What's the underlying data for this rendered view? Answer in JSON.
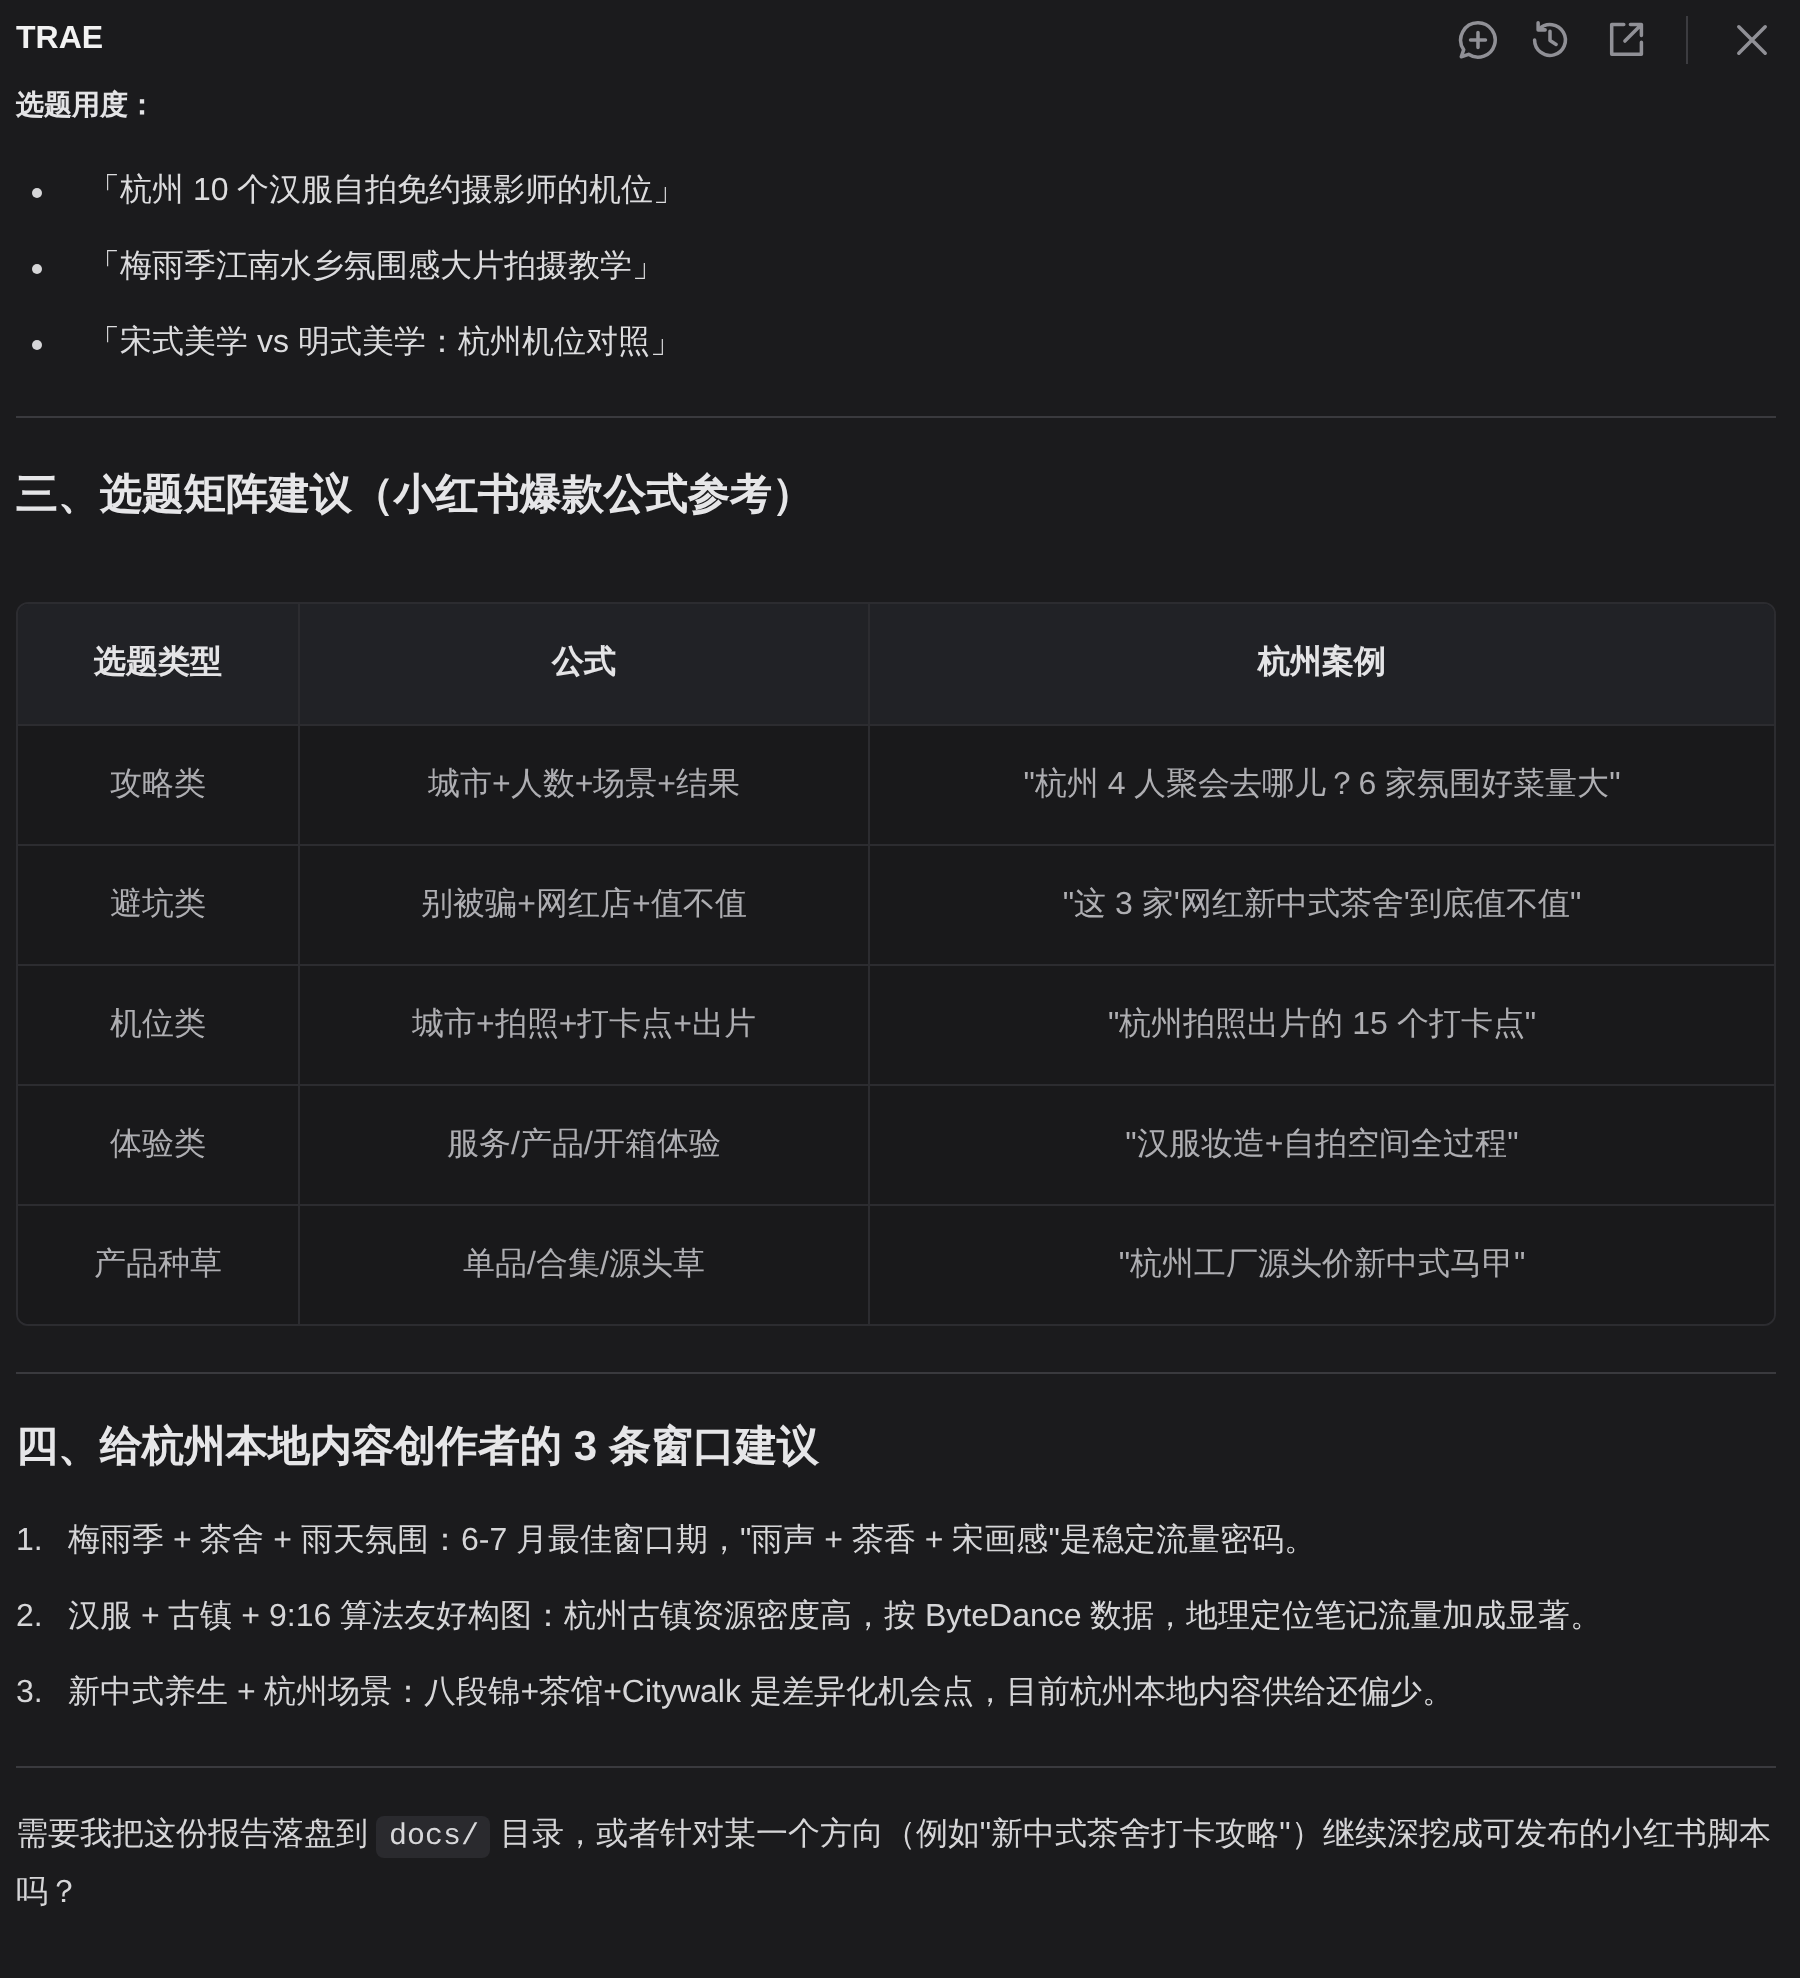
{
  "window": {
    "title": "TRAE"
  },
  "intro": {
    "label": "选题用度：",
    "bullets": [
      "「杭州 10 个汉服自拍免约摄影师的机位」",
      "「梅雨季江南水乡氛围感大片拍摄教学」",
      "「宋式美学 vs 明式美学：杭州机位对照」"
    ]
  },
  "matrix_section": {
    "heading": "三、选题矩阵建议（小红书爆款公式参考）",
    "table": {
      "columns": [
        "选题类型",
        "公式",
        "杭州案例"
      ],
      "rows": [
        [
          "攻略类",
          "城市+人数+场景+结果",
          "\"杭州 4 人聚会去哪儿？6 家氛围好菜量大\""
        ],
        [
          "避坑类",
          "别被骗+网红店+值不值",
          "\"这 3 家'网红新中式茶舍'到底值不值\""
        ],
        [
          "机位类",
          "城市+拍照+打卡点+出片",
          "\"杭州拍照出片的 15 个打卡点\""
        ],
        [
          "体验类",
          "服务/产品/开箱体验",
          "\"汉服妆造+自拍空间全过程\""
        ],
        [
          "产品种草",
          "单品/合集/源头草",
          "\"杭州工厂源头价新中式马甲\""
        ]
      ]
    }
  },
  "advice_section": {
    "heading": "四、给杭州本地内容创作者的 3 条窗口建议",
    "items": [
      {
        "number": "1.",
        "text": "梅雨季 + 茶舍 + 雨天氛围：6-7 月最佳窗口期，\"雨声 + 茶香 + 宋画感\"是稳定流量密码。"
      },
      {
        "number": "2.",
        "text": "汉服 + 古镇 + 9:16 算法友好构图：杭州古镇资源密度高，按 ByteDance 数据，地理定位笔记流量加成显著。"
      },
      {
        "number": "3.",
        "text": "新中式养生 + 杭州场景：八段锦+茶馆+Citywalk 是差异化机会点，目前杭州本地内容供给还偏少。"
      }
    ]
  },
  "closing": {
    "parts": [
      {
        "kind": "text",
        "text": "需要我把这份报告落盘到 "
      },
      {
        "kind": "code",
        "text": "docs/"
      },
      {
        "kind": "text",
        "text": " 目录，或者针对某一个方向（例如\"新中式茶舍打卡攻略\"）继续深挖成可发布的小红书脚本吗？"
      }
    ]
  }
}
